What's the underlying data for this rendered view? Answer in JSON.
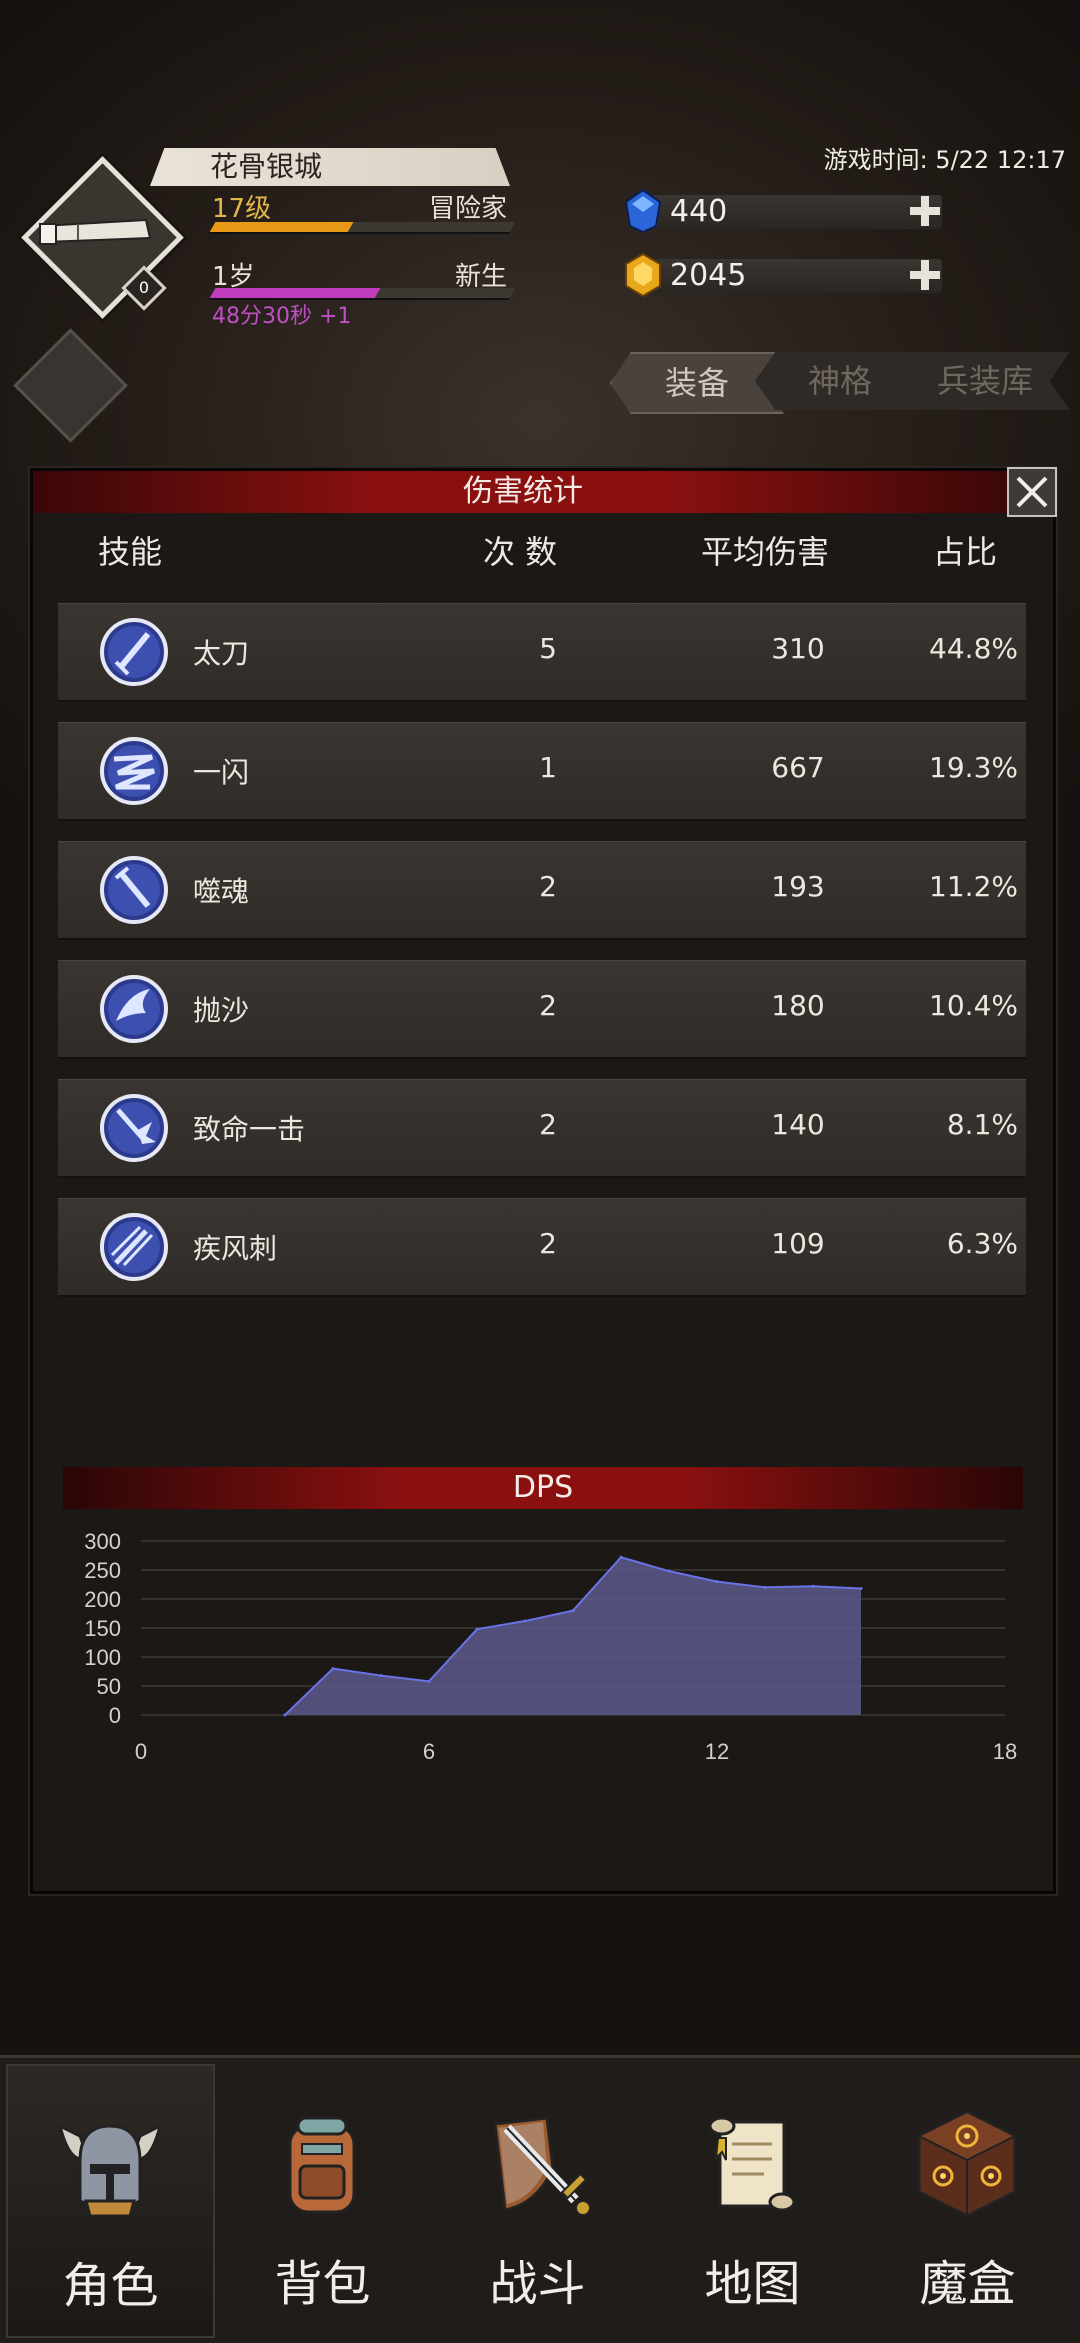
{
  "header": {
    "character_name": "花骨银城",
    "level_label": "17级",
    "class_label": "冒险家",
    "level_progress": 0.46,
    "age_label": "1岁",
    "age_stage": "新生",
    "age_progress": 0.55,
    "age_timer": "48分30秒 +1",
    "avatar_badge": "0",
    "game_time": "游戏时间: 5/22 12:17",
    "gems": "440",
    "gold": "2045"
  },
  "tabs": [
    "装备",
    "神格",
    "兵装库"
  ],
  "panel": {
    "title": "伤害统计",
    "columns": {
      "skill": "技能",
      "count": "次 数",
      "avg": "平均伤害",
      "share": "占比"
    },
    "rows": [
      {
        "name": "太刀",
        "count": "5",
        "avg": "310",
        "share": "44.8%",
        "icon": "sword-icon"
      },
      {
        "name": "一闪",
        "count": "1",
        "avg": "667",
        "share": "19.3%",
        "icon": "flash-slash-icon"
      },
      {
        "name": "噬魂",
        "count": "2",
        "avg": "193",
        "share": "11.2%",
        "icon": "soul-blade-icon"
      },
      {
        "name": "抛沙",
        "count": "2",
        "avg": "180",
        "share": "10.4%",
        "icon": "sand-throw-icon"
      },
      {
        "name": "致命一击",
        "count": "2",
        "avg": "140",
        "share": "8.1%",
        "icon": "critical-strike-icon"
      },
      {
        "name": "疾风刺",
        "count": "2",
        "avg": "109",
        "share": "6.3%",
        "icon": "gale-thrust-icon"
      }
    ],
    "dps_title": "DPS"
  },
  "chart_data": {
    "type": "area",
    "title": "DPS",
    "xlim": [
      0,
      18
    ],
    "ylim": [
      0,
      300
    ],
    "xticks": [
      "0",
      "6",
      "12",
      "18"
    ],
    "yticks": [
      "300",
      "250",
      "200",
      "150",
      "100",
      "50",
      "0"
    ],
    "grid": true,
    "color": "#5c5a8c",
    "line_color": "#6a72e8",
    "x": [
      3,
      4,
      5,
      6,
      7,
      8,
      9,
      10,
      11,
      12,
      13,
      14,
      15
    ],
    "y": [
      0,
      80,
      68,
      58,
      148,
      162,
      180,
      272,
      248,
      230,
      220,
      222,
      218
    ]
  },
  "nav": {
    "items": [
      {
        "label": "角色",
        "icon": "helmet-icon",
        "active": true
      },
      {
        "label": "背包",
        "icon": "backpack-icon",
        "active": false
      },
      {
        "label": "战斗",
        "icon": "sword-shield-icon",
        "active": false
      },
      {
        "label": "地图",
        "icon": "scroll-map-icon",
        "active": false
      },
      {
        "label": "魔盒",
        "icon": "magic-box-icon",
        "active": false
      }
    ]
  },
  "colors": {
    "accent_red": "#8a1010",
    "level_bar": "#e89a16",
    "age_bar": "#c03dbf",
    "level_text": "#e2b64a",
    "timer_text": "#c050c4"
  }
}
